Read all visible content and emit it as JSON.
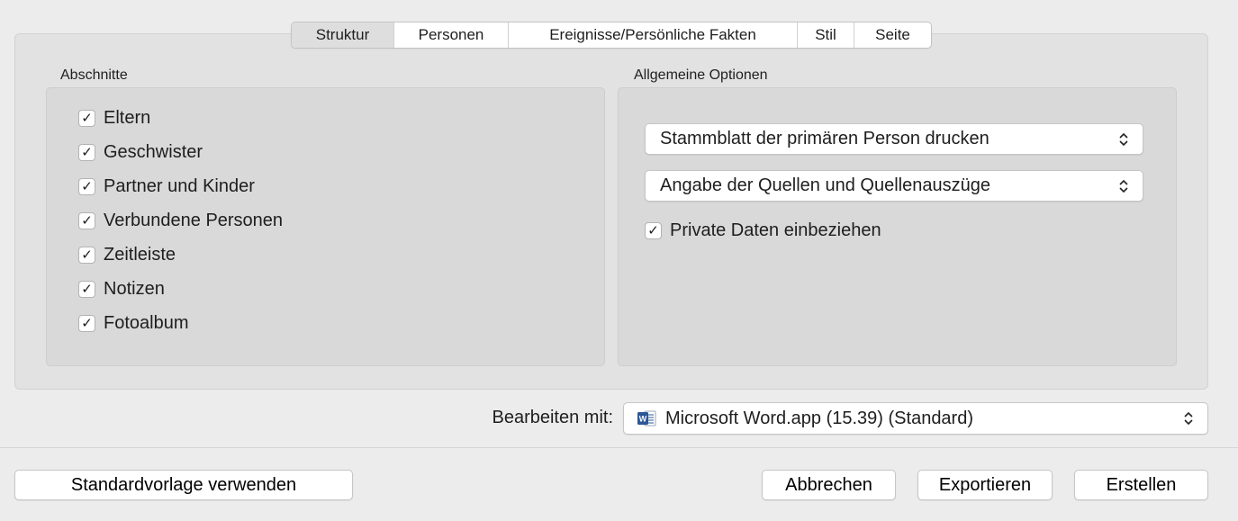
{
  "tabs": [
    {
      "label": "Struktur",
      "active": true
    },
    {
      "label": "Personen",
      "active": false
    },
    {
      "label": "Ereignisse/Persönliche Fakten",
      "active": false
    },
    {
      "label": "Stil",
      "active": false
    },
    {
      "label": "Seite",
      "active": false
    }
  ],
  "sections": {
    "title": "Abschnitte",
    "items": [
      {
        "label": "Eltern",
        "checked": true
      },
      {
        "label": "Geschwister",
        "checked": true
      },
      {
        "label": "Partner und Kinder",
        "checked": true
      },
      {
        "label": "Verbundene Personen",
        "checked": true
      },
      {
        "label": "Zeitleiste",
        "checked": true
      },
      {
        "label": "Notizen",
        "checked": true
      },
      {
        "label": "Fotoalbum",
        "checked": true
      }
    ]
  },
  "general_options": {
    "title": "Allgemeine Optionen",
    "popup1_value": "Stammblatt der primären Person drucken",
    "popup2_value": "Angabe der Quellen und Quellenauszüge",
    "private_data": {
      "label": "Private Daten einbeziehen",
      "checked": true
    }
  },
  "edit_with": {
    "label": "Bearbeiten mit:",
    "value": "Microsoft Word.app (15.39) (Standard)",
    "icon": "word-app-icon"
  },
  "buttons": {
    "default_template": "Standardvorlage verwenden",
    "cancel": "Abbrechen",
    "export": "Exportieren",
    "create": "Erstellen"
  },
  "check_glyph": "✓",
  "colors": {
    "window_bg": "#ececec",
    "group_bg": "#d9d9d9",
    "word_blue": "#2b5797"
  }
}
